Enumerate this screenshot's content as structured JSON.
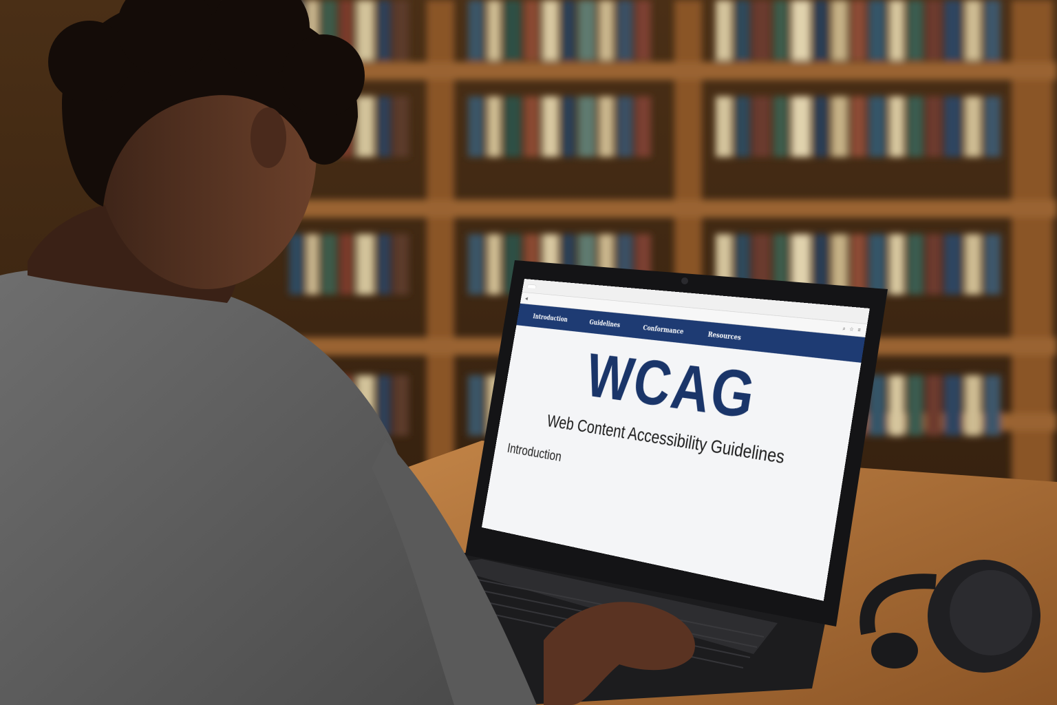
{
  "browser": {
    "tab_label": "",
    "url": ""
  },
  "nav": {
    "items": [
      "Introduction",
      "Guidelines",
      "Conformance",
      "Resources"
    ]
  },
  "hero": {
    "title": "WCAG",
    "subtitle": "Web Content Accessibility Guidelines"
  },
  "intro": {
    "heading": "Introduction",
    "body": ""
  },
  "colors": {
    "nav_bar": "#1e3b73",
    "title_text": "#1a3569",
    "shelf_wood": "#7a4a1f",
    "desk_wood": "#a86a33"
  }
}
